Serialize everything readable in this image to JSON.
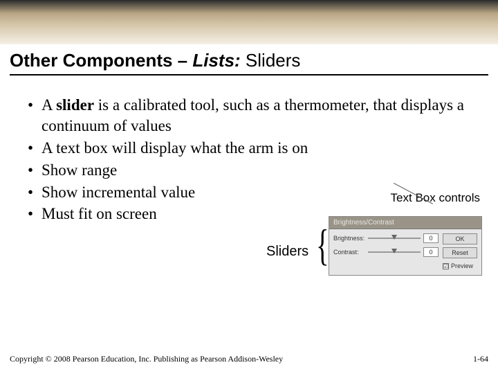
{
  "title": {
    "part1": "Other Components – ",
    "part2_italic": "Lists:",
    "part3": " Sliders"
  },
  "bullets": [
    {
      "prefix": "A ",
      "bold": "slider",
      "rest": " is a calibrated tool, such as a thermometer, that displays a continuum of values"
    },
    {
      "prefix": "",
      "bold": "",
      "rest": "A text box will display what the arm is on"
    },
    {
      "prefix": "",
      "bold": "",
      "rest": "Show range"
    },
    {
      "prefix": "",
      "bold": "",
      "rest": "Show incremental value"
    },
    {
      "prefix": "",
      "bold": "",
      "rest": "Must fit on screen"
    }
  ],
  "figure": {
    "textbox_label": "Text Box controls",
    "sliders_label": "Sliders",
    "dialog_title": "Brightness/Contrast",
    "rows": [
      {
        "label": "Brightness:",
        "value": "0"
      },
      {
        "label": "Contrast:",
        "value": "0"
      }
    ],
    "buttons": {
      "ok": "OK",
      "reset": "Reset"
    },
    "preview": "Preview",
    "check": "☑"
  },
  "footer": {
    "copyright": "Copyright © 2008 Pearson Education, Inc. Publishing as Pearson Addison-Wesley",
    "page": "1-64"
  }
}
